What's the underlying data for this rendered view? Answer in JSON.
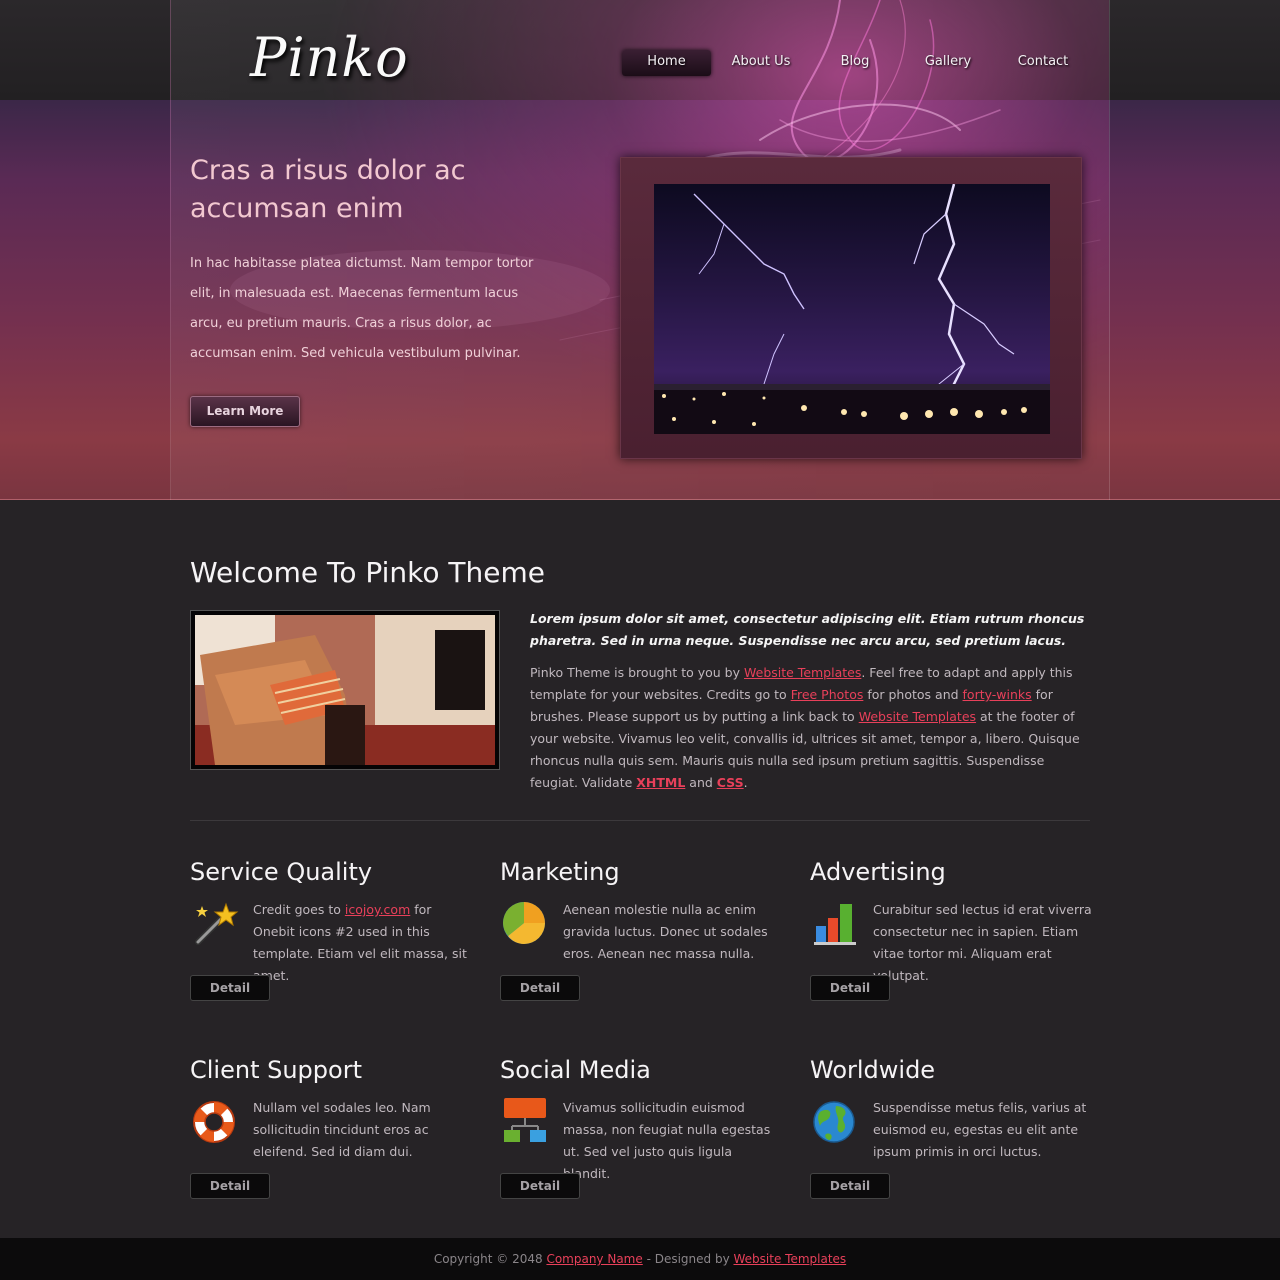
{
  "header": {
    "logo": "Pinko",
    "nav": [
      {
        "label": "Home",
        "active": true
      },
      {
        "label": "About Us",
        "active": false
      },
      {
        "label": "Blog",
        "active": false
      },
      {
        "label": "Gallery",
        "active": false
      },
      {
        "label": "Contact",
        "active": false
      }
    ]
  },
  "hero": {
    "title": "Cras a risus dolor ac accumsan enim",
    "text": "In hac habitasse platea dictumst. Nam tempor tortor elit, in malesuada est. Maecenas fermentum lacus arcu, eu pretium mauris. Cras a risus dolor, ac accumsan enim. Sed vehicula vestibulum pulvinar.",
    "button": "Learn More"
  },
  "welcome": {
    "title": "Welcome To Pinko Theme",
    "intro": "Lorem ipsum dolor sit amet, consectetur adipiscing elit. Etiam rutrum rhoncus pharetra. Sed in urna neque. Suspendisse nec arcu arcu, sed pretium lacus.",
    "p1": "Pinko Theme is brought to you by ",
    "link1": "Website Templates",
    "p2": ". Feel free to adapt and apply this template for your websites. Credits go to ",
    "link2": "Free Photos",
    "p3": " for photos and ",
    "link3": "forty-winks",
    "p4": " for brushes. Please support us by putting a link back to ",
    "link4": "Website Templates",
    "p5": " at the footer of your website. Vivamus leo velit, convallis id, ultrices sit amet, tempor a, libero. Quisque rhoncus nulla quis sem. Mauris quis nulla sed ipsum pretium sagittis. Suspendisse feugiat. Validate ",
    "link5": "XHTML",
    "p6": " and ",
    "link6": "CSS",
    "p7": "."
  },
  "services": [
    {
      "title": "Service Quality",
      "pre": "Credit goes to ",
      "link": "icojoy.com",
      "text": " for Onebit icons #2 used in this template. Etiam vel elit massa, sit amet.",
      "icon": "magic-wand-icon",
      "button": "Detail"
    },
    {
      "title": "Marketing",
      "pre": "",
      "link": "",
      "text": "Aenean molestie nulla ac enim gravida luctus. Donec ut sodales eros. Aenean nec massa nulla.",
      "icon": "pie-chart-icon",
      "button": "Detail"
    },
    {
      "title": "Advertising",
      "pre": "",
      "link": "",
      "text": "Curabitur sed lectus id erat viverra consectetur nec in sapien. Etiam vitae tortor mi. Aliquam erat volutpat.",
      "icon": "bar-chart-icon",
      "button": "Detail"
    },
    {
      "title": "Client Support",
      "pre": "",
      "link": "",
      "text": "Nullam vel sodales leo. Nam sollicitudin tincidunt eros ac eleifend. Sed id diam dui.",
      "icon": "lifebuoy-icon",
      "button": "Detail"
    },
    {
      "title": "Social Media",
      "pre": "",
      "link": "",
      "text": "Vivamus sollicitudin euismod massa, non feugiat nulla egestas ut. Sed vel justo quis ligula blandit.",
      "icon": "network-icon",
      "button": "Detail"
    },
    {
      "title": "Worldwide",
      "pre": "",
      "link": "",
      "text": "Suspendisse metus felis, varius at euismod eu, egestas eu elit ante ipsum primis in orci luctus.",
      "icon": "globe-icon",
      "button": "Detail"
    }
  ],
  "footer": {
    "pre": "Copyright © 2048 ",
    "company": "Company Name",
    "mid": " - Designed by ",
    "designer": "Website Templates"
  }
}
